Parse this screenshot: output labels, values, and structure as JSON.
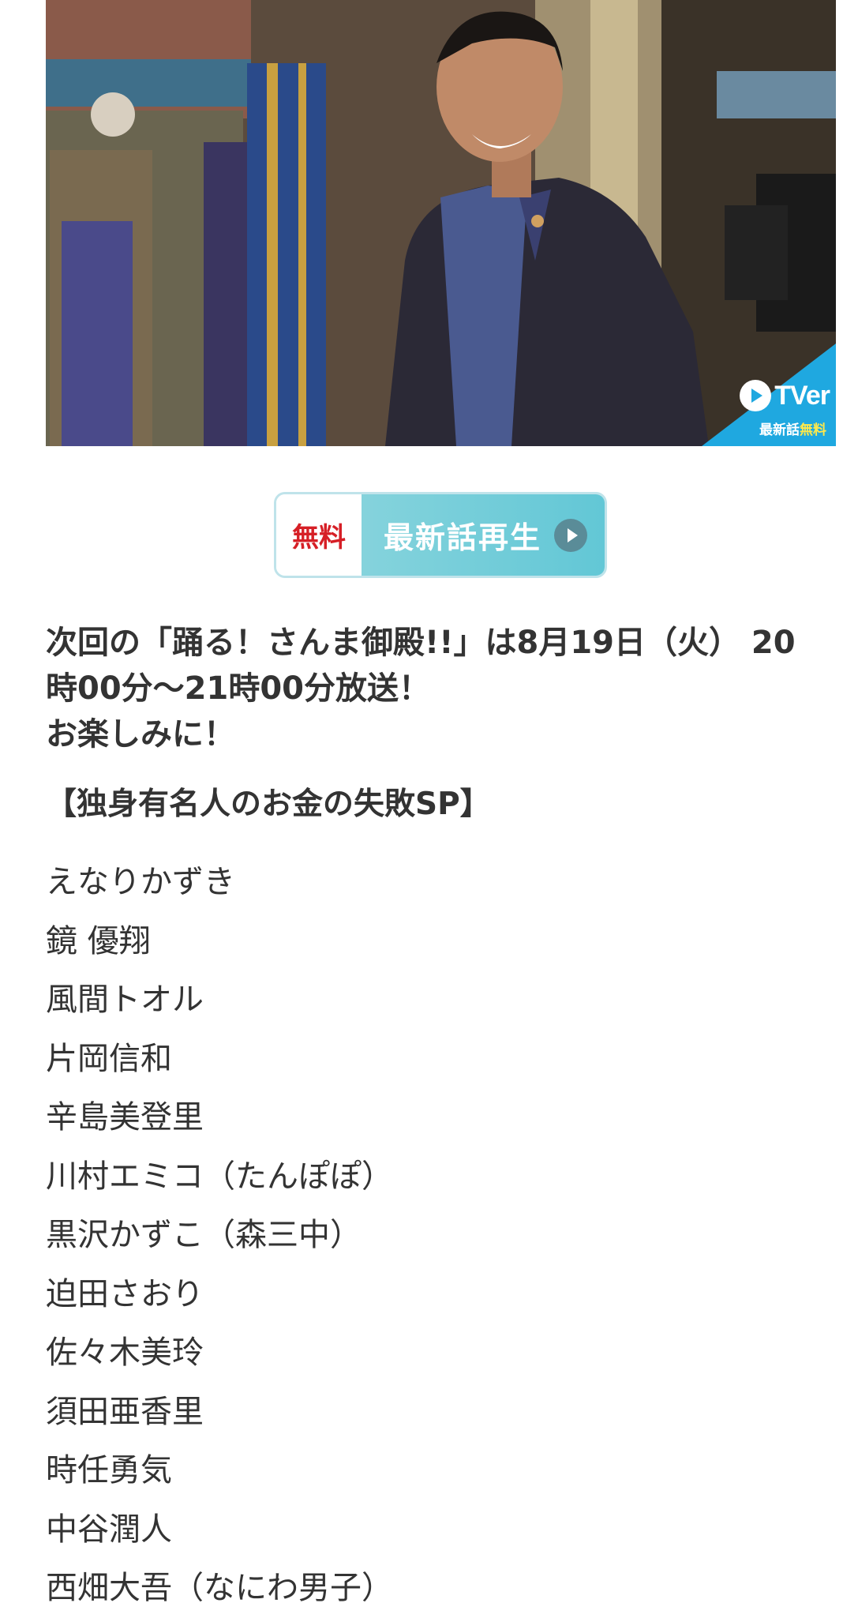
{
  "hero": {
    "image_alt": "Program host laughing on studio set",
    "tver_badge": {
      "logo": "TVer",
      "label_prefix": "最新話",
      "label_free": "無料",
      "icon": "play-icon"
    }
  },
  "play_button": {
    "free_label": "無料",
    "label": "最新話再生",
    "icon": "play-icon"
  },
  "announcement": {
    "line1": "次回の「踊る！さんま御殿!!」は8月19日（火） 20",
    "line2": "時00分〜21時00分放送！",
    "line3": "お楽しみに！"
  },
  "special_title": "【独身有名人のお金の失敗SP】",
  "cast": [
    "えなりかずき",
    "鏡 優翔",
    "風間トオル",
    "片岡信和",
    "辛島美登里",
    "川村エミコ（たんぽぽ）",
    "黒沢かずこ（森三中）",
    "迫田さおり",
    "佐々木美玲",
    "須田亜香里",
    "時任勇気",
    "中谷潤人",
    "西畑大吾（なにわ男子）"
  ],
  "colors": {
    "free_red": "#d61f26",
    "accent_teal": "#62c7d6",
    "tver_blue": "#1fa8e0",
    "text": "#333333"
  }
}
